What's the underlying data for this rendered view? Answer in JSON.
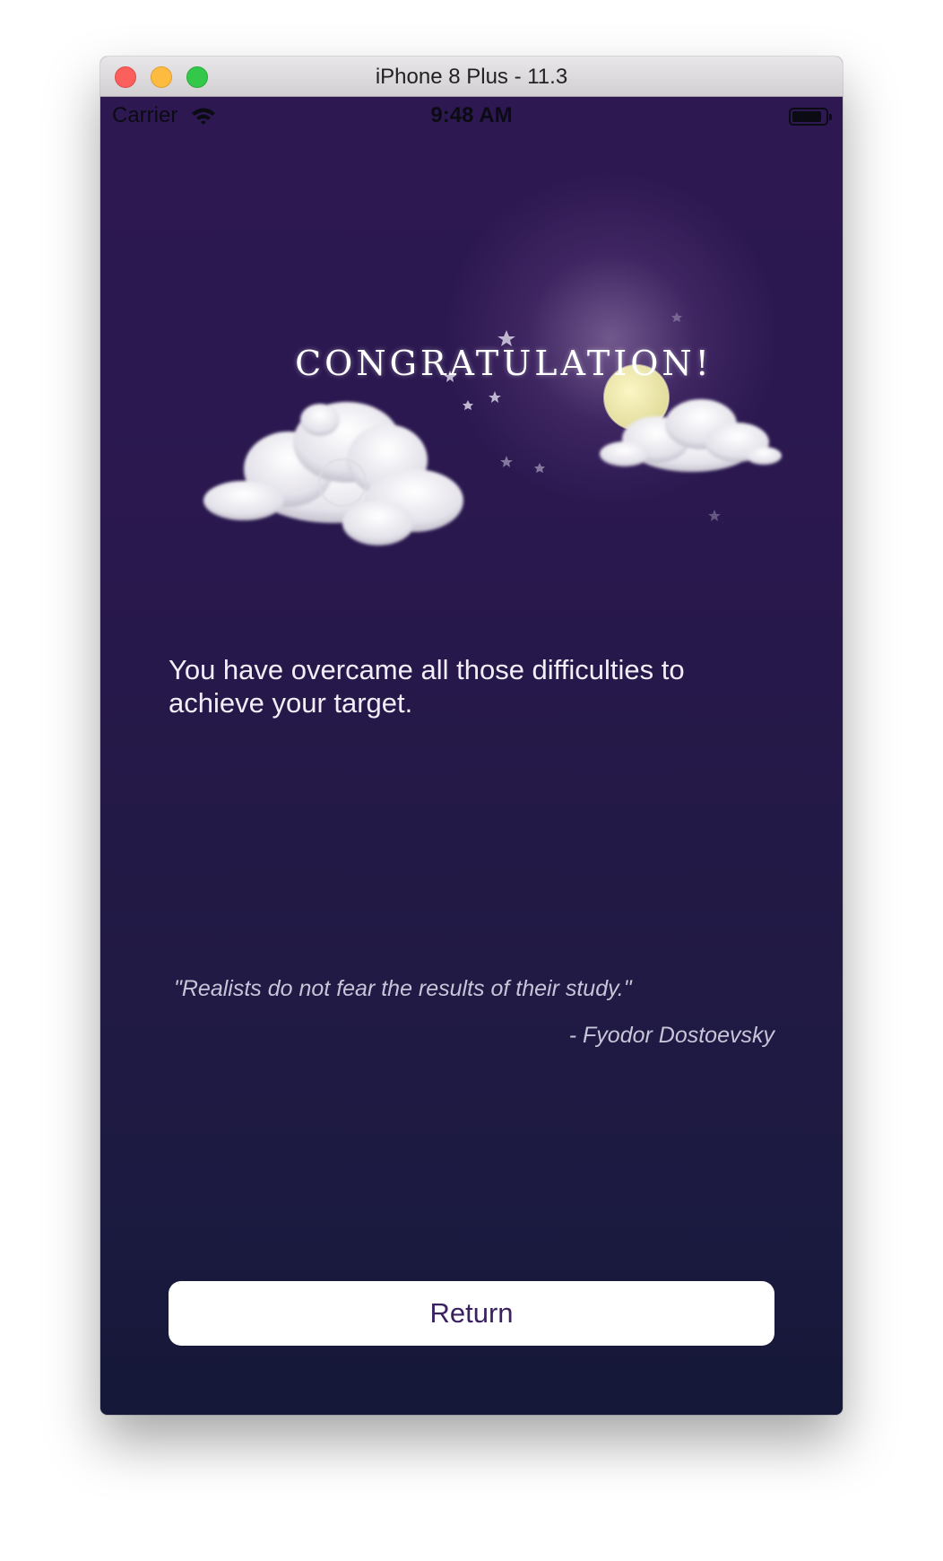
{
  "window": {
    "title": "iPhone 8 Plus - 11.3"
  },
  "status_bar": {
    "carrier": "Carrier",
    "time": "9:48 AM",
    "wifi_icon": "wifi-icon",
    "battery_icon": "battery-icon"
  },
  "hero": {
    "headline": "CONGRATULATION!",
    "decorations": [
      "cloud-illustration",
      "moon-illustration",
      "star-icon"
    ]
  },
  "message": "You have overcame all those difficulties to achieve your target.",
  "quote": {
    "text": "\"Realists do not fear the results of their study.\"",
    "author": "- Fyodor Dostoevsky"
  },
  "actions": {
    "return_label": "Return"
  },
  "colors": {
    "background_top": "#2e1852",
    "background_bottom": "#151838",
    "button_background": "#ffffff",
    "button_text": "#3a2160"
  }
}
